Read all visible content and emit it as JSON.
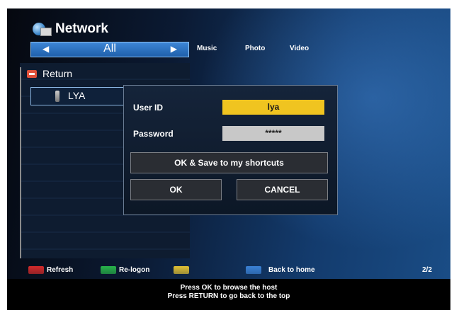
{
  "header": {
    "title": "Network",
    "icon": "network-globe-icon",
    "selector_label": "All",
    "tabs": [
      "Music",
      "Photo",
      "Video"
    ]
  },
  "list": {
    "return_label": "Return",
    "item_label": "LYA"
  },
  "dialog": {
    "user_id_label": "User ID",
    "user_id_value": "lya",
    "password_label": "Password",
    "password_value": "*****",
    "save_button": "OK & Save to my shortcuts",
    "ok_button": "OK",
    "cancel_button": "CANCEL"
  },
  "footer": {
    "keys": [
      {
        "color": "#d62b2b",
        "label": "Refresh"
      },
      {
        "color": "#28b44a",
        "label": "Re-logon"
      },
      {
        "color": "#e3c233",
        "label": ""
      },
      {
        "color": "#3b82d6",
        "label": "Back to home"
      }
    ],
    "page": "2/2",
    "hint_line1": "Press OK to browse the host",
    "hint_line2": "Press RETURN to go back to the top"
  }
}
